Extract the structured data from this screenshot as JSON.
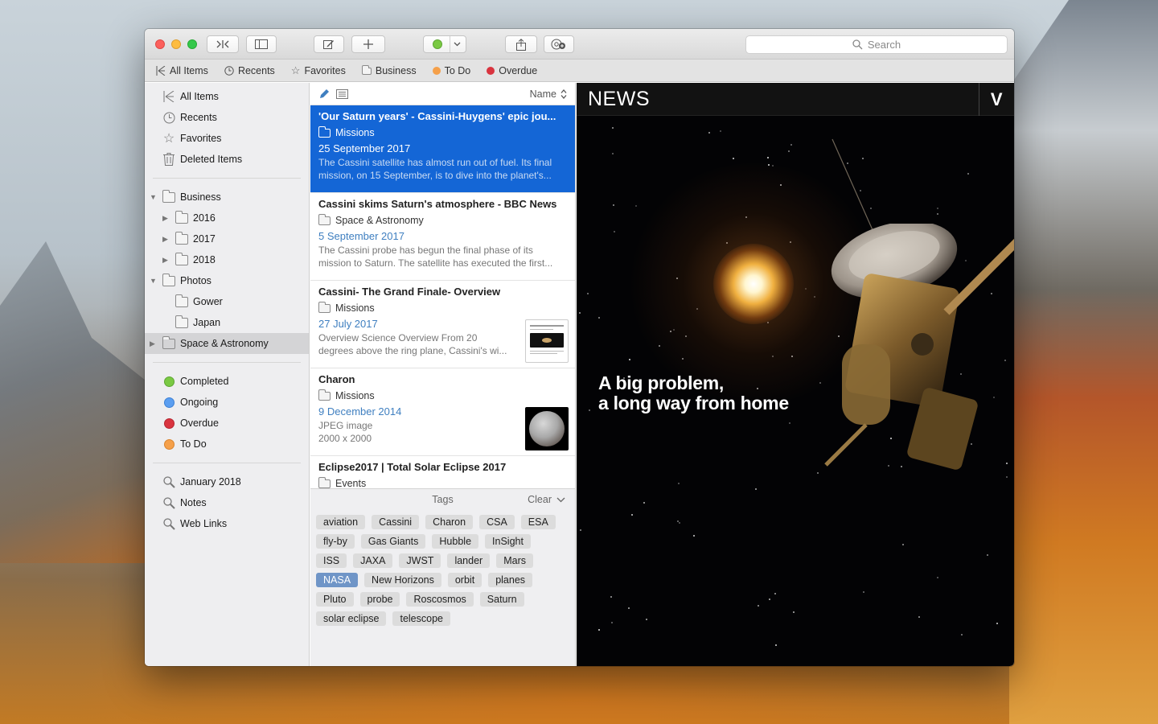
{
  "toolbar": {
    "search_placeholder": "Search"
  },
  "favorites_bar": [
    {
      "label": "All Items",
      "icon": "all-items-icon"
    },
    {
      "label": "Recents",
      "icon": "clock-icon"
    },
    {
      "label": "Favorites",
      "icon": "star-icon"
    },
    {
      "label": "Business",
      "icon": "folder-icon"
    },
    {
      "label": "To Do",
      "icon": "dot",
      "color": "#f5a04a"
    },
    {
      "label": "Overdue",
      "icon": "dot",
      "color": "#d9343f"
    }
  ],
  "sidebar": {
    "library": [
      {
        "label": "All Items",
        "icon": "all-items-icon"
      },
      {
        "label": "Recents",
        "icon": "clock-icon"
      },
      {
        "label": "Favorites",
        "icon": "star-icon"
      },
      {
        "label": "Deleted Items",
        "icon": "trash-icon"
      }
    ],
    "folders": [
      {
        "label": "Business",
        "level": 0,
        "disclosure": "open"
      },
      {
        "label": "2016",
        "level": 1,
        "disclosure": "closed"
      },
      {
        "label": "2017",
        "level": 1,
        "disclosure": "closed"
      },
      {
        "label": "2018",
        "level": 1,
        "disclosure": "closed"
      },
      {
        "label": "Photos",
        "level": 0,
        "disclosure": "open"
      },
      {
        "label": "Gower",
        "level": 1,
        "disclosure": "none"
      },
      {
        "label": "Japan",
        "level": 1,
        "disclosure": "none"
      },
      {
        "label": "Space & Astronomy",
        "level": 0,
        "disclosure": "closed",
        "selected": true
      }
    ],
    "statuses": [
      {
        "label": "Completed",
        "color": "#7ac943"
      },
      {
        "label": "Ongoing",
        "color": "#5b9ef0"
      },
      {
        "label": "Overdue",
        "color": "#d9343f"
      },
      {
        "label": "To Do",
        "color": "#f5a04a"
      }
    ],
    "smart_searches": [
      {
        "label": "January 2018"
      },
      {
        "label": "Notes"
      },
      {
        "label": "Web Links"
      }
    ]
  },
  "list": {
    "sort_label": "Name",
    "items": [
      {
        "title": "'Our Saturn years' - Cassini-Huygens' epic jou...",
        "group": "Missions",
        "date": "25 September 2017",
        "snippet_1": "The Cassini satellite has almost run out of fuel. Its final",
        "snippet_2": "mission, on 15 September, is to dive into the planet's...",
        "selected": true
      },
      {
        "title": "Cassini skims Saturn's atmosphere - BBC News",
        "group": "Space & Astronomy",
        "date": "5 September 2017",
        "snippet_1": "The Cassini probe has begun the final phase of its",
        "snippet_2": "mission to Saturn. The satellite has executed the first..."
      },
      {
        "title": "Cassini- The Grand Finale- Overview",
        "group": "Missions",
        "date": "27 July 2017",
        "snippet_1": "Overview Science Overview From 20",
        "snippet_2": "degrees above the ring plane, Cassini's wi..."
      },
      {
        "title": "Charon",
        "group": "Missions",
        "date": "9 December 2014",
        "snippet_1": "JPEG image",
        "snippet_2": "2000 x 2000"
      },
      {
        "title": "Eclipse2017 | Total Solar Eclipse 2017",
        "group": "Events",
        "date": "",
        "snippet_1": "",
        "snippet_2": ""
      }
    ]
  },
  "tags": {
    "header": "Tags",
    "clear_label": "Clear",
    "items": [
      {
        "label": "aviation"
      },
      {
        "label": "Cassini"
      },
      {
        "label": "Charon"
      },
      {
        "label": "CSA"
      },
      {
        "label": "ESA"
      },
      {
        "label": "fly-by"
      },
      {
        "label": "Gas Giants"
      },
      {
        "label": "Hubble"
      },
      {
        "label": "InSight"
      },
      {
        "label": "ISS"
      },
      {
        "label": "JAXA"
      },
      {
        "label": "JWST"
      },
      {
        "label": "lander"
      },
      {
        "label": "Mars"
      },
      {
        "label": "NASA",
        "selected": true
      },
      {
        "label": "New Horizons"
      },
      {
        "label": "orbit"
      },
      {
        "label": "planes"
      },
      {
        "label": "Pluto"
      },
      {
        "label": "probe"
      },
      {
        "label": "Roscosmos"
      },
      {
        "label": "Saturn"
      },
      {
        "label": "solar eclipse"
      },
      {
        "label": "telescope"
      }
    ]
  },
  "preview": {
    "site_name": "NEWS",
    "menu_glyph": "V",
    "headline_1": "A big problem,",
    "headline_2": "a long way from home"
  }
}
